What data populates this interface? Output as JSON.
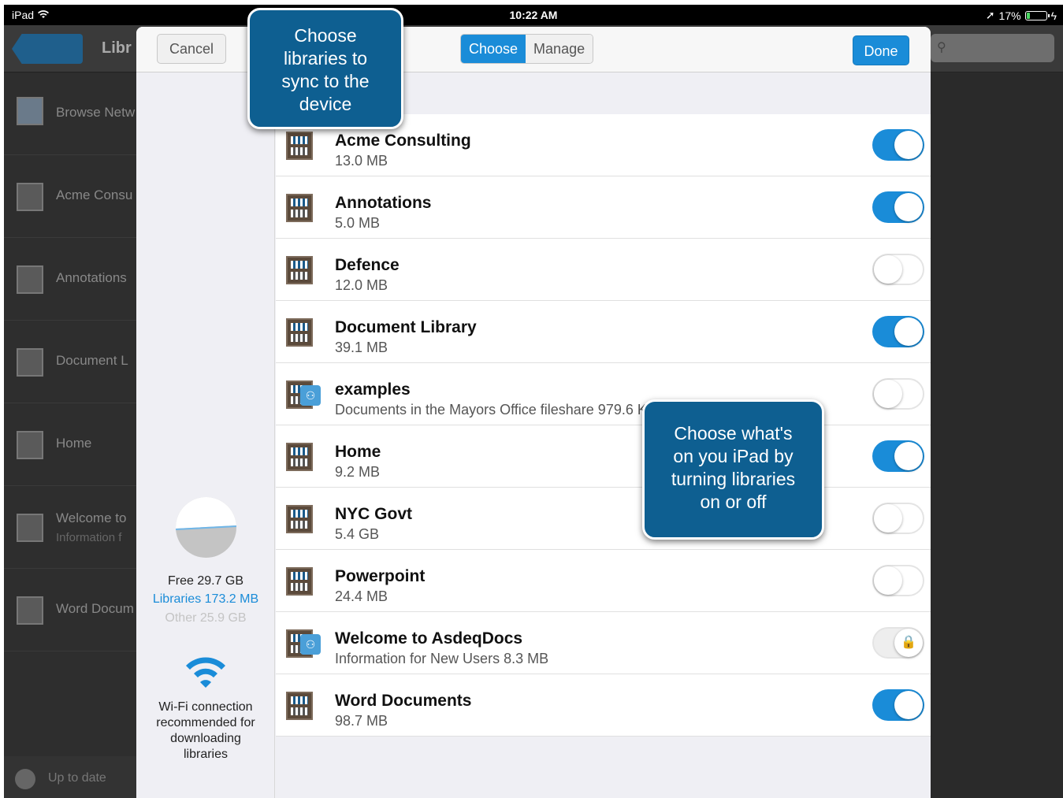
{
  "statusbar": {
    "device": "iPad",
    "time": "10:22 AM",
    "battery": "17%"
  },
  "background": {
    "title": "Libr",
    "sidebar": [
      {
        "label": "Browse Netw",
        "sub": ""
      },
      {
        "label": "Acme Consu",
        "sub": ""
      },
      {
        "label": "Annotations",
        "sub": ""
      },
      {
        "label": "Document L",
        "sub": ""
      },
      {
        "label": "Home",
        "sub": ""
      },
      {
        "label": "Welcome to",
        "sub": "Information f"
      },
      {
        "label": "Word Docum",
        "sub": ""
      }
    ],
    "footer_status": "Up to date"
  },
  "modal": {
    "cancel_label": "Cancel",
    "segments": [
      "Choose",
      "Manage"
    ],
    "done_label": "Done",
    "storage": {
      "free": "Free 29.7 GB",
      "libraries": "Libraries 173.2 MB",
      "other": "Other 25.9 GB"
    },
    "wifi_message_lines": [
      "Wi-Fi connection",
      "recommended for",
      "downloading",
      "libraries"
    ],
    "libraries": [
      {
        "name": "Acme Consulting",
        "size": "13.0 MB",
        "state": "on",
        "shared": false
      },
      {
        "name": "Annotations",
        "size": "5.0 MB",
        "state": "on",
        "shared": false
      },
      {
        "name": "Defence",
        "size": "12.0 MB",
        "state": "off",
        "shared": false
      },
      {
        "name": "Document Library",
        "size": "39.1 MB",
        "state": "on",
        "shared": false
      },
      {
        "name": "examples",
        "size": "Documents in the Mayors Office fileshare 979.6 KB",
        "state": "off",
        "shared": true
      },
      {
        "name": "Home",
        "size": "9.2 MB",
        "state": "on",
        "shared": false
      },
      {
        "name": "NYC Govt",
        "size": "5.4 GB",
        "state": "off",
        "shared": false
      },
      {
        "name": "Powerpoint",
        "size": "24.4 MB",
        "state": "off",
        "shared": false
      },
      {
        "name": "Welcome to AsdeqDocs",
        "size": "Information for New Users 8.3 MB",
        "state": "locked",
        "shared": true
      },
      {
        "name": "Word Documents",
        "size": "98.7 MB",
        "state": "on",
        "shared": false
      }
    ]
  },
  "callouts": {
    "top_lines": [
      "Choose",
      "libraries to",
      "sync to the",
      "device"
    ],
    "right_lines": [
      "Choose what's",
      "on you iPad by",
      "turning libraries",
      "on or off"
    ]
  },
  "colors": {
    "accent": "#1a8cd8",
    "callout": "#0e5f91"
  }
}
